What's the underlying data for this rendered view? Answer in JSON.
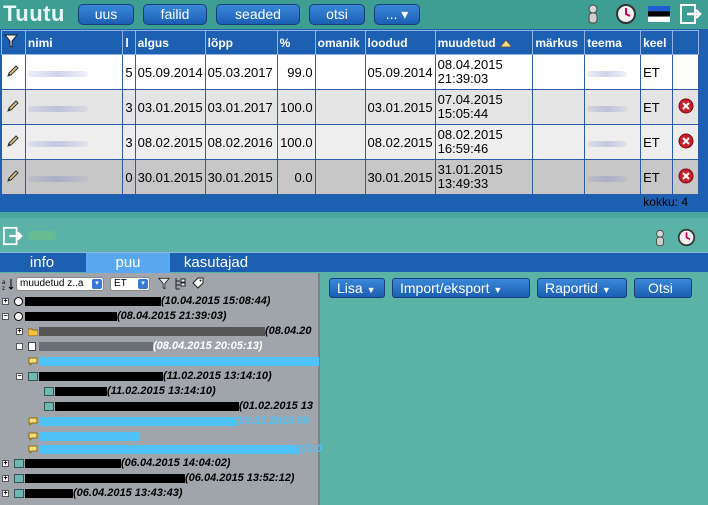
{
  "app": {
    "title": "Tuutu"
  },
  "toolbar": {
    "buttons": [
      "uus",
      "failid",
      "seaded",
      "otsi",
      "... ▾"
    ]
  },
  "grid": {
    "headers": [
      "nimi",
      "l",
      "algus",
      "lõpp",
      "%",
      "omanik",
      "loodud",
      "muudetud",
      "märkus",
      "teema",
      "keel"
    ],
    "rows": [
      {
        "l": "5",
        "algus": "05.09.2014",
        "lopp": "05.03.2017",
        "pct": "99.0",
        "loodud": "05.09.2014",
        "muudetud": "08.04.2015",
        "muudetud_time": "21:39:03",
        "keel": "ET"
      },
      {
        "l": "3",
        "algus": "03.01.2015",
        "lopp": "03.01.2017",
        "pct": "100.0",
        "loodud": "03.01.2015",
        "muudetud": "07.04.2015",
        "muudetud_time": "15:05:44",
        "keel": "ET"
      },
      {
        "l": "3",
        "algus": "08.02.2015",
        "lopp": "08.02.2016",
        "pct": "100.0",
        "loodud": "08.02.2015",
        "muudetud": "08.02.2015",
        "muudetud_time": "16:59:46",
        "keel": "ET"
      },
      {
        "l": "0",
        "algus": "30.01.2015",
        "lopp": "30.01.2015",
        "pct": "0.0",
        "loodud": "30.01.2015",
        "muudetud": "31.01.2015",
        "muudetud_time": "13:49:33",
        "keel": "ET"
      }
    ],
    "total": "kokku: 4"
  },
  "tabs": [
    "info",
    "puu",
    "kasutajad"
  ],
  "tree": {
    "sort_select": "muudetud z..a",
    "lang_select": "ET",
    "nodes": [
      {
        "date": "(10.04.2015 15:08:44)"
      },
      {
        "date": "(08.04.2015 21:39:03)"
      },
      {
        "date": "(08.04.20"
      },
      {
        "date": "(08.04.2015 20:05:13)"
      },
      {
        "date": "(11.02.2015 13:14:10)"
      },
      {
        "date": "(11.02.2015 13:14:10)"
      },
      {
        "date": "(01.02.2015 13"
      },
      {
        "date": "(03.01.2015 09"
      },
      {
        "date": "(03.0"
      },
      {
        "date": "(06.04.2015 14:04:02)"
      },
      {
        "date": "(06.04.2015 13:52:12)"
      },
      {
        "date": "(06.04.2015 13:43:43)"
      }
    ]
  },
  "actions": [
    "Lisa",
    "Import/eksport",
    "Raportid",
    "Otsi"
  ],
  "colors": {
    "header_blue": "#1d5fb1",
    "background_teal": "#5bb3a8",
    "tab_active": "#5aa8f0"
  }
}
